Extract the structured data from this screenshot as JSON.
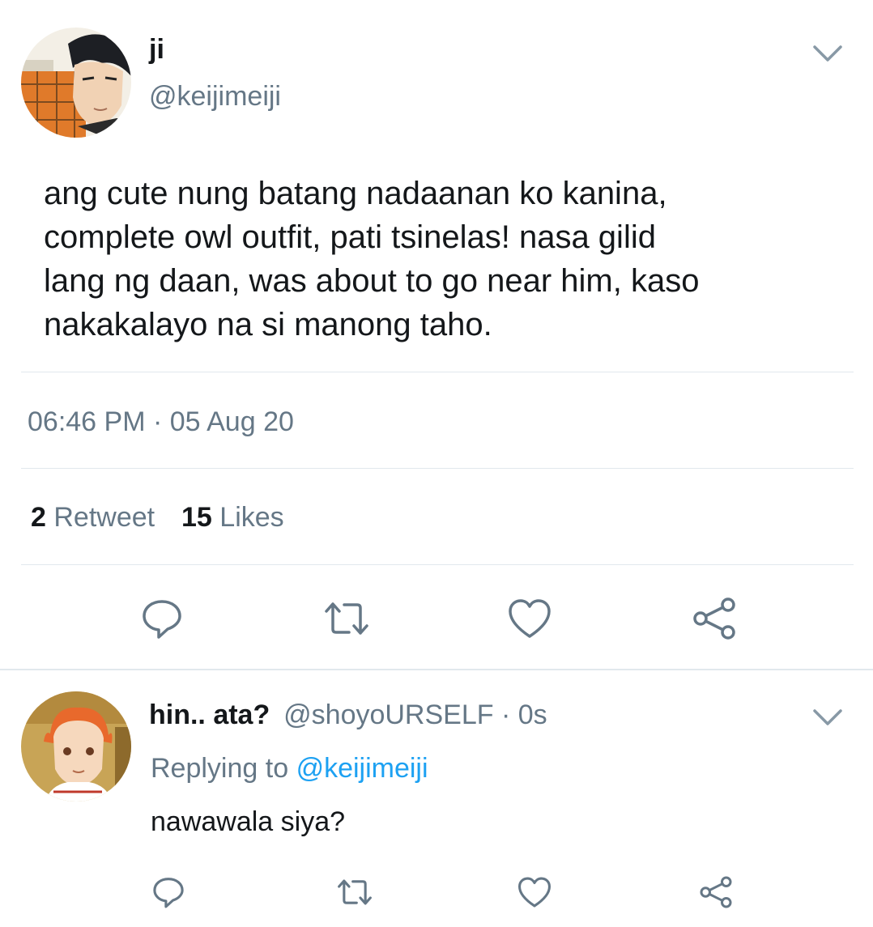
{
  "tweet": {
    "display_name": "ji",
    "handle": "@keijimeiji",
    "text_lines": [
      "ang cute nung batang nadaanan ko kanina,",
      "complete owl outfit, pati tsinelas! nasa gilid",
      "lang ng daan, was about to go near him, kaso",
      "nakakalayo na si manong taho."
    ],
    "timestamp": "06:46 PM · 05 Aug 20",
    "retweet_count": "2",
    "retweet_label": "Retweet",
    "likes_count": "15",
    "likes_label": "Likes",
    "actions": [
      "reply-icon",
      "retweet-icon",
      "heart-icon",
      "share-icon"
    ]
  },
  "reply": {
    "display_name": "hin.. ata?",
    "handle_time": "@shoyoURSELF · 0s",
    "replying_to_label": "Replying to",
    "replying_to_handle": "@keijimeiji",
    "text": "nawawala siya?",
    "actions": [
      "reply-icon",
      "retweet-icon",
      "heart-icon",
      "share-icon"
    ]
  },
  "colors": {
    "text": "#14171a",
    "secondary": "#657786",
    "link": "#1da1f2",
    "divider": "#e1e8ed"
  }
}
